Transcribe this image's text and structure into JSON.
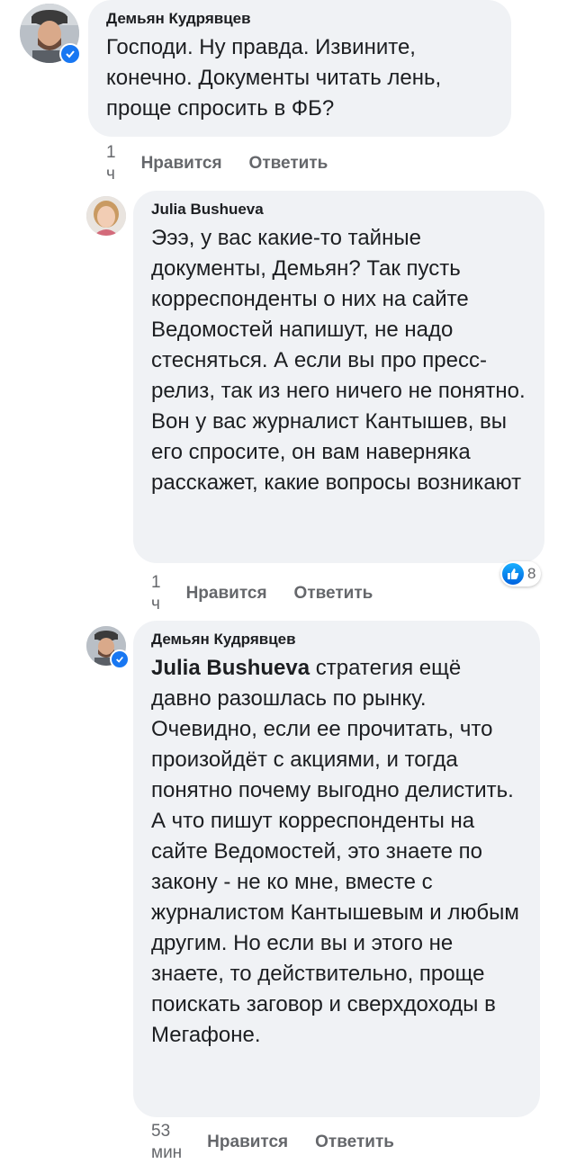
{
  "comments": [
    {
      "author": "Демьян Кудрявцев",
      "verified": true,
      "text": "Господи. Ну правда.  Извините, конечно. Документы читать лень, проще спросить в ФБ?",
      "time": "1 ч",
      "like_label": "Нравится",
      "reply_label": "Ответить"
    },
    {
      "author": "Julia Bushueva",
      "verified": false,
      "text": "Эээ, у вас какие-то тайные документы, Демьян? Так пусть корреспонденты о них на сайте Ведомостей напишут, не надо стесняться. А если вы про пресс-релиз, так из него ничего не понятно. Вон у вас журналист Кантышев, вы его спросите, он вам наверняка расскажет, какие вопросы возникают",
      "time": "1 ч",
      "like_label": "Нравится",
      "reply_label": "Ответить",
      "reaction": {
        "icon": "thumbs-up-icon",
        "count": "8"
      }
    },
    {
      "author": "Демьян Кудрявцев",
      "verified": true,
      "mention": "Julia Bushueva",
      "text": " стратегия ещё давно  разошлась по рынку. Очевидно, если ее прочитать, что произойдёт с акциями, и тогда понятно почему выгодно делистить. А что пишут корреспонденты на сайте Ведомостей, это знаете по закону - не ко мне, вместе с журналистом Кантышевым и любым другим. Но если вы и этого не знаете, то действительно, проще поискать заговор и сверхдоходы в Мегафоне.",
      "time": "53 мин",
      "like_label": "Нравится",
      "reply_label": "Ответить"
    }
  ],
  "colors": {
    "bubble": "#f0f2f5",
    "meta": "#65676b",
    "verified": "#1877f2",
    "like": "#0062df"
  }
}
